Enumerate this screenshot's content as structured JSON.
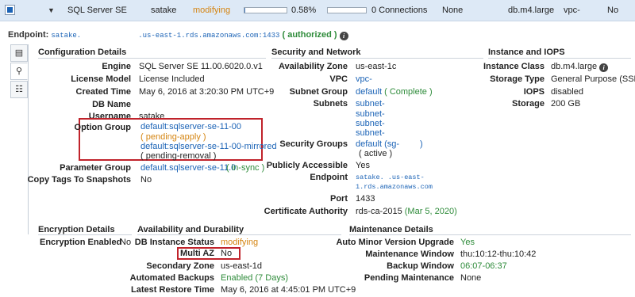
{
  "row": {
    "engine": "SQL Server SE",
    "identifier": "satake",
    "status": "modifying",
    "cpu_percent": "0.58%",
    "cpu_fill": 0.0058,
    "connections": "0 Connections",
    "replication": "None",
    "instance_class": "db.m4.large",
    "vpc": "vpc-",
    "multi_az": "No"
  },
  "endpoint": {
    "label": "Endpoint:",
    "host_prefix": "satake.",
    "host_suffix": ".us-east-1.rds.amazonaws.com:1433",
    "authorized": "( authorized )"
  },
  "config": {
    "heading": "Configuration Details",
    "engine_k": "Engine",
    "engine_v": "SQL Server SE 11.00.6020.0.v1",
    "license_k": "License Model",
    "license_v": "License Included",
    "created_k": "Created Time",
    "created_v": "May 6, 2016 at 3:20:30 PM UTC+9",
    "dbname_k": "DB Name",
    "dbname_v": "",
    "username_k": "Username",
    "username_v": "satake",
    "optgroup_k": "Option Group",
    "optgroup_1": "default:sqlserver-se-11-00",
    "optgroup_1_status": "( pending-apply )",
    "optgroup_2": "default:sqlserver-se-11-00-mirrored",
    "optgroup_2_status": "( pending-removal )",
    "paramgroup_k": "Parameter Group",
    "paramgroup_v": "default.sqlserver-se-11.0",
    "paramgroup_status": "( in-sync )",
    "copytags_k": "Copy Tags To Snapshots",
    "copytags_v": "No"
  },
  "network": {
    "heading": "Security and Network",
    "az_k": "Availability Zone",
    "az_v": "us-east-1c",
    "vpc_k": "VPC",
    "vpc_v": "vpc-",
    "subnetgroup_k": "Subnet Group",
    "subnetgroup_v": "default",
    "subnetgroup_status": "( Complete )",
    "subnets_k": "Subnets",
    "subnets": [
      "subnet-",
      "subnet-",
      "subnet-",
      "subnet-"
    ],
    "secgroups_k": "Security Groups",
    "secgroups_v": "default (sg-",
    "secgroups_close": ")",
    "secgroups_status": "( active )",
    "public_k": "Publicly Accessible",
    "public_v": "Yes",
    "endpoint_k": "Endpoint",
    "endpoint_l1": "satake.              .us-east-",
    "endpoint_l2": "1.rds.amazonaws.com",
    "port_k": "Port",
    "port_v": "1433",
    "ca_k": "Certificate Authority",
    "ca_v": "rds-ca-2015",
    "ca_date": "(Mar 5, 2020)"
  },
  "iops": {
    "heading": "Instance and IOPS",
    "class_k": "Instance Class",
    "class_v": "db.m4.large",
    "storagetype_k": "Storage Type",
    "storagetype_v": "General Purpose (SSD)",
    "iops_k": "IOPS",
    "iops_v": "disabled",
    "storage_k": "Storage",
    "storage_v": "200 GB"
  },
  "encryption": {
    "heading": "Encryption Details",
    "enabled_k": "Encryption Enabled",
    "enabled_v": "No"
  },
  "availability": {
    "heading": "Availability and Durability",
    "status_k": "DB Instance Status",
    "status_v": "modifying",
    "multiaz_k": "Multi AZ",
    "multiaz_v": "No",
    "secondary_k": "Secondary Zone",
    "secondary_v": "us-east-1d",
    "backups_k": "Automated Backups",
    "backups_v": "Enabled (7 Days)",
    "restore_k": "Latest Restore Time",
    "restore_v": "May 6, 2016 at 4:45:01 PM UTC+9"
  },
  "maintenance": {
    "heading": "Maintenance Details",
    "autominor_k": "Auto Minor Version Upgrade",
    "autominor_v": "Yes",
    "window_k": "Maintenance Window",
    "window_v": "thu:10:12-thu:10:42",
    "backup_k": "Backup Window",
    "backup_v": "06:07-06:37",
    "pending_k": "Pending Maintenance",
    "pending_v": "None"
  },
  "icons": {
    "monitor": "chart-icon",
    "details": "magnify-icon",
    "topology": "hierarchy-icon",
    "info": "info-icon"
  }
}
